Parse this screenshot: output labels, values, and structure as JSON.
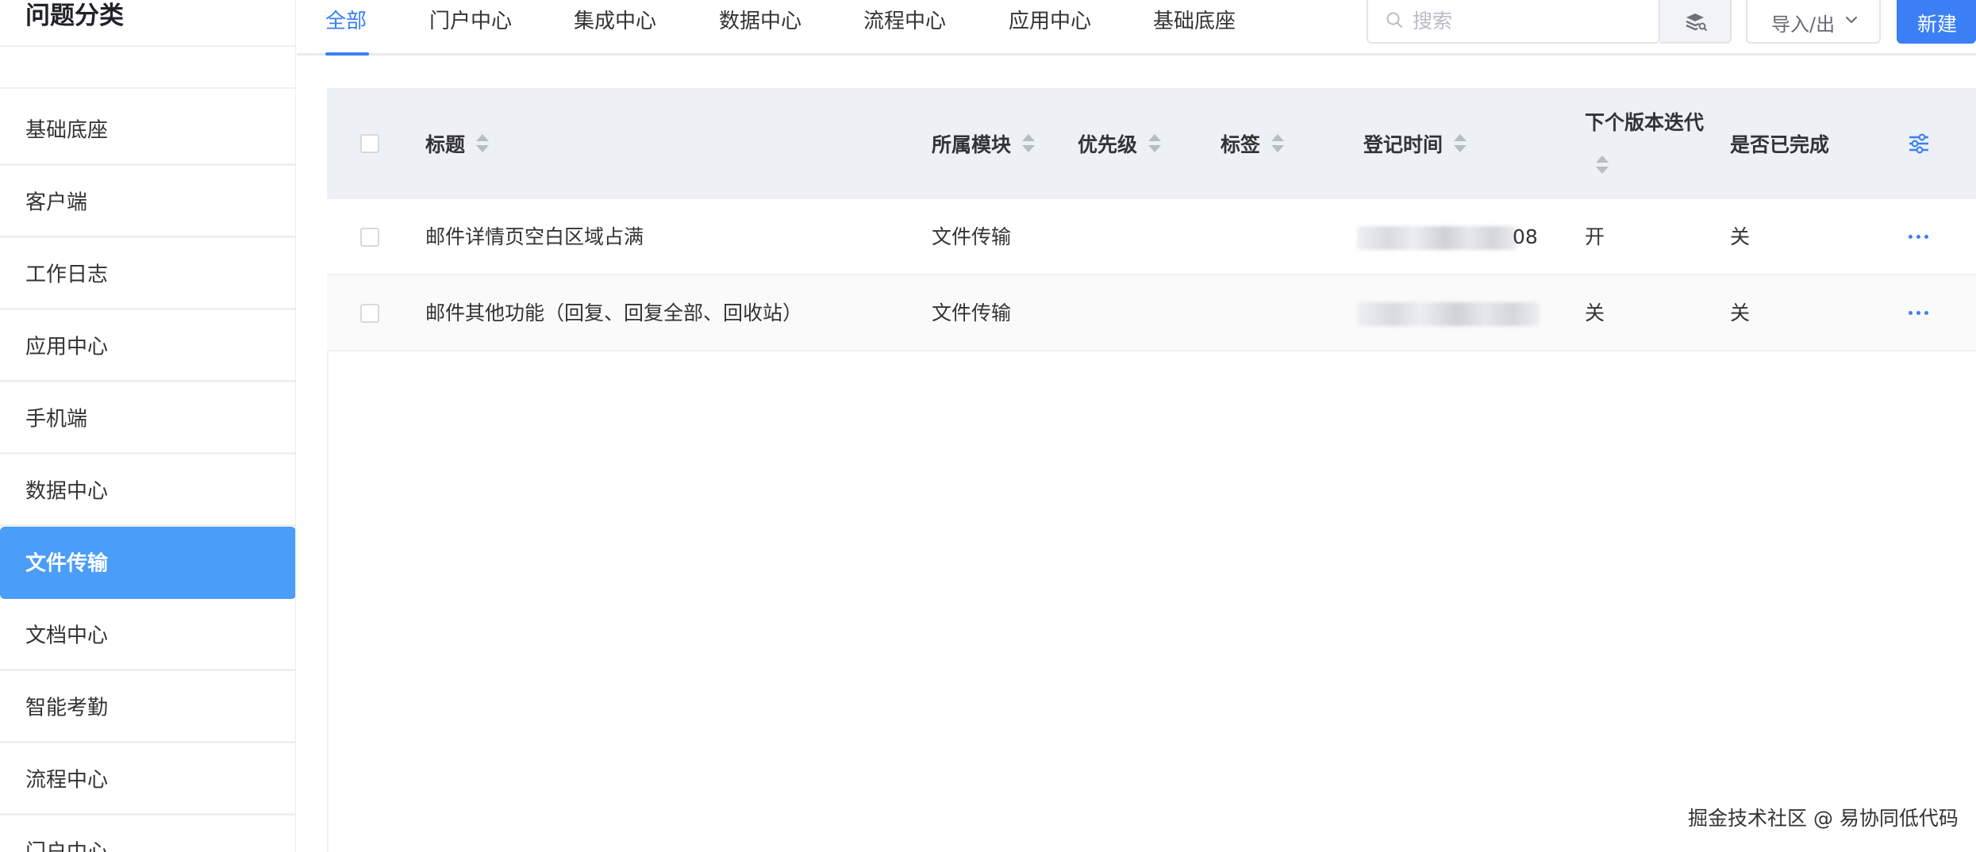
{
  "sidebar": {
    "title": "问题分类",
    "items": [
      {
        "label": "基础底座",
        "active": false
      },
      {
        "label": "客户端",
        "active": false
      },
      {
        "label": "工作日志",
        "active": false
      },
      {
        "label": "应用中心",
        "active": false
      },
      {
        "label": "手机端",
        "active": false
      },
      {
        "label": "数据中心",
        "active": false
      },
      {
        "label": "文件传输",
        "active": true
      },
      {
        "label": "文档中心",
        "active": false
      },
      {
        "label": "智能考勤",
        "active": false
      },
      {
        "label": "流程中心",
        "active": false
      },
      {
        "label": "门户中心",
        "active": false
      }
    ]
  },
  "tabs": [
    {
      "label": "全部",
      "active": true
    },
    {
      "label": "门户中心",
      "active": false
    },
    {
      "label": "集成中心",
      "active": false
    },
    {
      "label": "数据中心",
      "active": false
    },
    {
      "label": "流程中心",
      "active": false
    },
    {
      "label": "应用中心",
      "active": false
    },
    {
      "label": "基础底座",
      "active": false
    }
  ],
  "toolbar": {
    "search_placeholder": "搜索",
    "import_label": "导入/出",
    "new_label": "新建"
  },
  "table": {
    "headers": {
      "title": "标题",
      "module": "所属模块",
      "priority": "优先级",
      "tag": "标签",
      "register_time": "登记时间",
      "next_version": "下个版本迭代",
      "completed": "是否已完成"
    },
    "rows": [
      {
        "title": "邮件详情页空白区域占满",
        "module": "文件传输",
        "priority": "",
        "tag": "",
        "register_time_visible": "08",
        "next_version": "开",
        "completed": "关"
      },
      {
        "title": "邮件其他功能（回复、回复全部、回收站）",
        "module": "文件传输",
        "priority": "",
        "tag": "",
        "register_time_visible": "",
        "next_version": "关",
        "completed": "关"
      }
    ]
  },
  "watermark": "掘金技术社区 @ 易协同低代码",
  "colors": {
    "accent": "#3b7ff5",
    "sidebar_active": "#4a9df8",
    "header_bg": "#edf1f6"
  },
  "icons": [
    "search-icon",
    "database-search-icon",
    "chevron-down-icon",
    "column-settings-icon",
    "more-icon"
  ]
}
